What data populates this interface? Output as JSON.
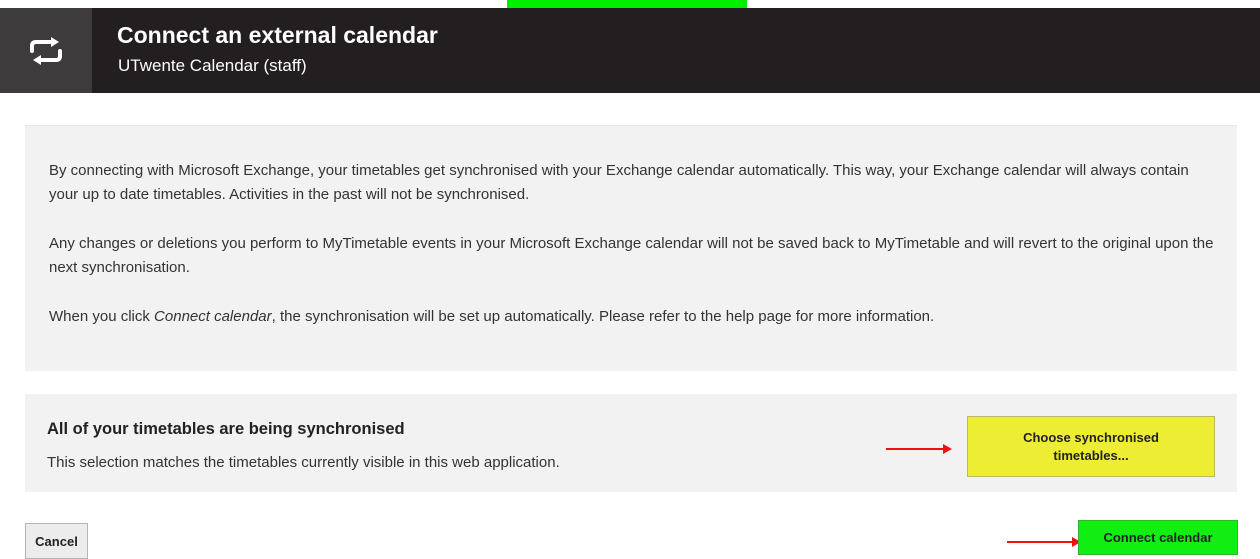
{
  "header": {
    "icon": "sync-arrows-icon",
    "title": "Connect an external calendar",
    "subtitle": "UTwente Calendar (staff)"
  },
  "info": {
    "paragraph1": "By connecting with Microsoft Exchange, your timetables get synchronised with your Exchange calendar automatically. This way, your Exchange calendar will always contain your up to date timetables. Activities in the past will not be synchronised.",
    "paragraph2": "Any changes or deletions you perform to MyTimetable events in your Microsoft Exchange calendar will not be saved back to MyTimetable and will revert to the original upon the next synchronisation.",
    "paragraph3_prefix": "When you click ",
    "paragraph3_italic": "Connect calendar",
    "paragraph3_suffix": ", the synchronisation will be set up automatically. Please refer to the help page for more information."
  },
  "sync": {
    "title": "All of your timetables are being synchronised",
    "description": "This selection matches the timetables currently visible in this web application.",
    "choose_label": "Choose synchronised timetables..."
  },
  "actions": {
    "cancel_label": "Cancel",
    "connect_label": "Connect calendar"
  },
  "colors": {
    "header_bg": "#231f20",
    "panel_bg": "#f2f2f2",
    "choose_button": "#eded33",
    "connect_button": "#11ee11",
    "arrow": "#ee1111"
  }
}
